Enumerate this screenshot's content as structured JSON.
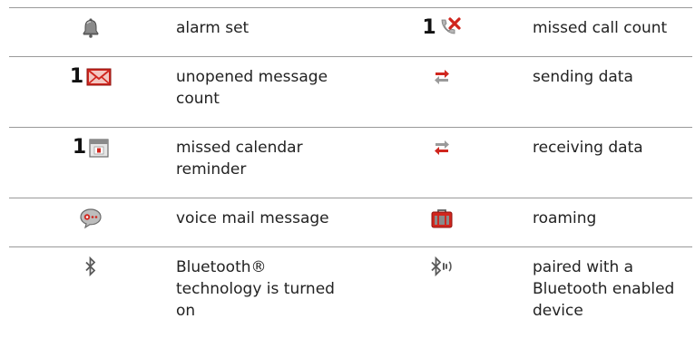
{
  "rows": [
    {
      "left": {
        "icon": "alarm-bell-icon",
        "count": "",
        "label": "alarm set"
      },
      "right": {
        "icon": "missed-call-icon",
        "count": "1",
        "label": "missed call count"
      }
    },
    {
      "left": {
        "icon": "unopened-message-icon",
        "count": "1",
        "label": "unopened message count"
      },
      "right": {
        "icon": "sending-data-icon",
        "count": "",
        "label": "sending data"
      }
    },
    {
      "left": {
        "icon": "calendar-reminder-icon",
        "count": "1",
        "label": "missed calendar reminder"
      },
      "right": {
        "icon": "receiving-data-icon",
        "count": "",
        "label": "receiving data"
      }
    },
    {
      "left": {
        "icon": "voice-mail-icon",
        "count": "",
        "label": "voice mail message"
      },
      "right": {
        "icon": "roaming-icon",
        "count": "",
        "label": "roaming"
      }
    },
    {
      "left": {
        "icon": "bluetooth-icon",
        "count": "",
        "label": "Bluetooth® technology is turned on"
      },
      "right": {
        "icon": "bluetooth-paired-icon",
        "count": "",
        "label": "paired with a Bluetooth enabled device"
      }
    }
  ],
  "colors": {
    "rule": "#9a9a9a",
    "accent_red": "#d0261e",
    "icon_gray": "#808080",
    "text": "#222222"
  }
}
